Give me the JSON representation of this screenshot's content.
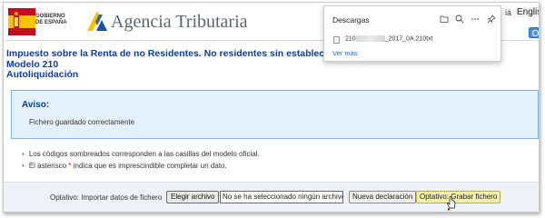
{
  "header": {
    "gov_text": [
      "GOBIERNO",
      "DE ESPAÑA"
    ],
    "agency_name": "Agencia Tributaria",
    "lang_partial": "iá",
    "lang_english": "English"
  },
  "title": {
    "line1": "Impuesto sobre la Renta de no Residentes. No residentes sin establecimi",
    "line2": "Modelo 210",
    "line3": "Autoliquidación"
  },
  "aviso": {
    "title": "Aviso:",
    "message": "Fichero guardado correctamente"
  },
  "notes": {
    "line1": "Los códigos sombreados corresponden a las casillas del modelo oficial.",
    "line2_before": "El asterisco ",
    "line2_star": "*",
    "line2_after": " indica que es imprescindible completar un dato."
  },
  "actions": {
    "import_label": "Optativo: Importar datos de fichero",
    "choose_file": "Elegir archivo",
    "no_file": "No se ha seleccionado ningún archivo",
    "new_declaration": "Nueva declaración",
    "save_file": "Optativo: Grabar fichero"
  },
  "downloads": {
    "title": "Descargas",
    "file_prefix": "210",
    "file_suffix": "_2017_0A.210txt",
    "see_more": "Ver más",
    "icons": [
      "folder-icon",
      "search-icon",
      "more-icon",
      "pin-icon"
    ]
  },
  "colors": {
    "title_blue": "#0b3ea0",
    "aviso_bg": "#e4f1fb",
    "save_button_bg": "#f5f0a8",
    "link_blue": "#1a6fc9"
  }
}
